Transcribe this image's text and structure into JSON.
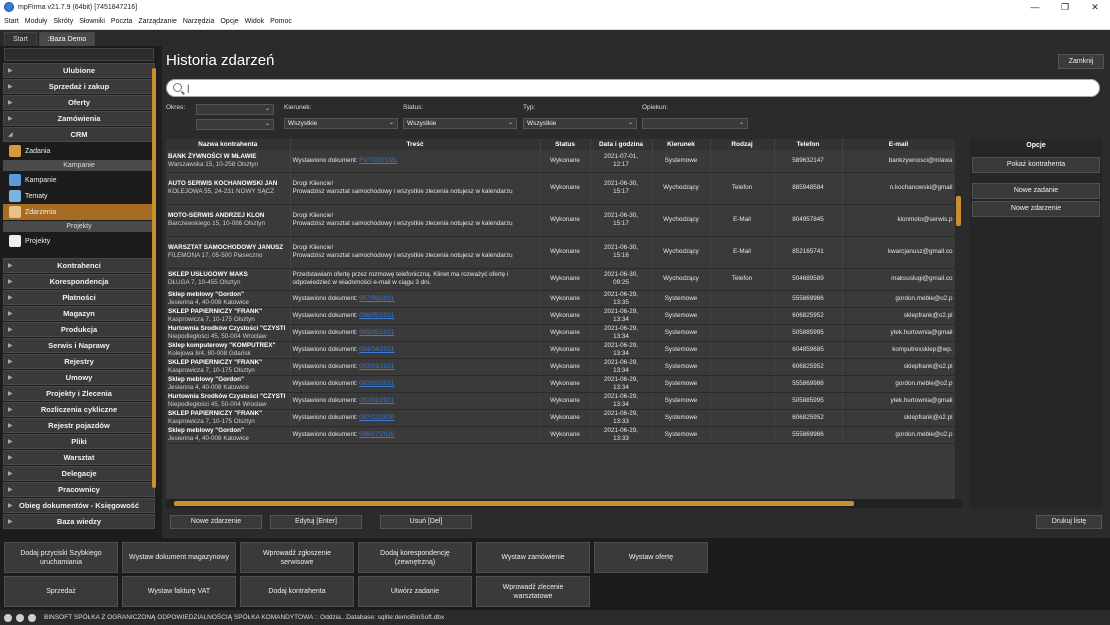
{
  "window": {
    "title": "mpFirma v21.7.9 (64bit) [7451847216]",
    "minimize": "—",
    "maximize": "❐",
    "close": "✕"
  },
  "menu": [
    "Start",
    "Moduły",
    "Skróty",
    "Słowniki",
    "Poczta",
    "Zarządzanie",
    "Narzędzia",
    "Opcje",
    "Widok",
    "Pomoc"
  ],
  "top_tabs": [
    "Start",
    ":Baza Demo"
  ],
  "sidebar": {
    "groups_top": [
      "Ulubione",
      "Sprzedaż i zakup",
      "Oferty",
      "Zamówienia",
      "CRM"
    ],
    "crm_items": [
      {
        "label": "Zadania",
        "section": "Kampanie"
      },
      {
        "label": "Kampanie"
      },
      {
        "label": "Tematy"
      },
      {
        "label": "Zdarzenia",
        "section": "Projekty",
        "active": true
      },
      {
        "label": "Projekty"
      }
    ],
    "groups_bottom": [
      "Kontrahenci",
      "Korespondencja",
      "Płatności",
      "Magazyn",
      "Produkcja",
      "Serwis i Naprawy",
      "Rejestry",
      "Umowy",
      "Projekty i Zlecenia",
      "Rozliczenia cykliczne",
      "Rejestr pojazdów",
      "Pliki",
      "Warsztat",
      "Delegacje",
      "Pracownicy",
      "Obieg dokumentów - Księgowość",
      "Baza wiedzy"
    ]
  },
  "main": {
    "title": "Historia zdarzeń",
    "close_label": "Zamknij",
    "search_value": "|",
    "filters": [
      {
        "label": "Okres:",
        "value": ""
      },
      {
        "label": "Kierunek:",
        "value": "Wszystkie"
      },
      {
        "label": "Status:",
        "value": "Wszystkie"
      },
      {
        "label": "Typ:",
        "value": "Wszystkie"
      },
      {
        "label": "Opiekun:",
        "value": ""
      }
    ],
    "columns": [
      "Nazwa kontrahenta",
      "Treść",
      "Status",
      "Data i godzina",
      "Kierunek",
      "Rodzaj",
      "Telefon",
      "E-mail"
    ],
    "rows": [
      {
        "name": "BANK ŻYWNOŚCI W MŁAWIE",
        "addr": "Warszawska 15, 10-258 Olsztyn",
        "text": "Wystawiono dokument: ",
        "link": "FV/7/2021/ZL",
        "status": "Wykonane",
        "date": "2021-07-01,",
        "time": "12:17",
        "dir": "Systemowe",
        "kind": "",
        "phone": "589632147",
        "email": "bankzywnosci@mlawa",
        "size": "r2"
      },
      {
        "name": "AUTO SERWIS KOCHANOWSKI JAN",
        "addr": "KOLEJOWA 55, 24-231 NOWY SĄCZ",
        "text": "Drogi Kliencie!",
        "text2": "Prowadzisz warsztat samochodowy i wszystkie zlecenia notujesz w kalendarzu",
        "status": "Wykonane",
        "date": "2021-06-30,",
        "time": "15:17",
        "dir": "Wychodzący",
        "kind": "Telefon",
        "phone": "885948584",
        "email": "n.kochanowski@gmail",
        "size": "r3"
      },
      {
        "name": "MOTO-SERWIS ANDRZEJ KLON",
        "addr": "Barczewskiego 15, 10-086 Olsztyn",
        "text": "Drogi Kliencie!",
        "text2": "Prowadzisz warsztat samochodowy i wszystkie zlecenia notujesz w kalendarzu",
        "status": "Wykonane",
        "date": "2021-06-30,",
        "time": "15:17",
        "dir": "Wychodzący",
        "kind": "E-Mail",
        "phone": "804957845",
        "email": "klonmoto@serwis.p",
        "size": "r3"
      },
      {
        "name": "WARSZTAT SAMOCHODOWY JANUSZ",
        "addr": "FILEMONA 17, 05-500 Piaseczno",
        "text": "Drogi Kliencie!",
        "text2": "Prowadzisz warsztat samochodowy i wszystkie zlecenia notujesz w kalendarzu",
        "status": "Wykonane",
        "date": "2021-06-30,",
        "time": "15:16",
        "dir": "Wychodzący",
        "kind": "E-Mail",
        "phone": "852165741",
        "email": "kwarcjanusz@gmail.co",
        "size": "r3"
      },
      {
        "name": "SKLEP USŁUGOWY MAKS",
        "addr": "DŁUGA 7, 10-455 Olsztyn",
        "text": "Przedstawiam ofertę przez rozmowę telefoniczną. Klinet ma rozważyć ofertę i",
        "text2": "odpowiedzieć w wiadomości e-mail w ciągu 3 dni.",
        "status": "Wykonane",
        "date": "2021-06-30,",
        "time": "09:25",
        "dir": "Wychodzący",
        "kind": "Telefon",
        "phone": "504689589",
        "email": "maksuslugi@gmail.co",
        "size": "r2"
      },
      {
        "name": "Sklep meblowy \"Gordon\"",
        "addr": "Jesienna 4, 40-008 Katowice",
        "text": "Wystawiono dokument: ",
        "link": "007/06/2021",
        "status": "Wykonane",
        "date": "2021-06-29,",
        "time": "13:35",
        "dir": "Systemowe",
        "kind": "",
        "phone": "555869986",
        "email": "gordon.meble@o2.p",
        "size": "r1"
      },
      {
        "name": "SKLEP PAPIERNICZY \"FRANK\"",
        "addr": "Kasprowicza 7, 10-175 Olsztyn",
        "text": "Wystawiono dokument: ",
        "link": "006/05/2021",
        "status": "Wykonane",
        "date": "2021-06-29,",
        "time": "13:34",
        "dir": "Systemowe",
        "kind": "",
        "phone": "606825952",
        "email": "sklepfrank@o2.pl",
        "size": "r1"
      },
      {
        "name": "Hurtownia Środków Czystości \"CZYSTI",
        "addr": "Niepodległości 45, 50-004 Wrocław",
        "text": "Wystawiono dokument: ",
        "link": "005/05/2021",
        "status": "Wykonane",
        "date": "2021-06-29,",
        "time": "13:34",
        "dir": "Systemowe",
        "kind": "",
        "phone": "505885995",
        "email": "ytek.hurtownia@gmail",
        "size": "r1"
      },
      {
        "name": "Sklep komputerowy \"KOMPUTREX\"",
        "addr": "Kolejowa 8/4, 80-008 Gdańsk",
        "text": "Wystawiono dokument: ",
        "link": "004/04/2021",
        "status": "Wykonane",
        "date": "2021-06-29,",
        "time": "13:34",
        "dir": "Systemowe",
        "kind": "",
        "phone": "604859685",
        "email": "komputrexsklep@wp.",
        "size": "r1"
      },
      {
        "name": "SKLEP PAPIERNICZY \"FRANK\"",
        "addr": "Kasprowicza 7, 10-175 Olsztyn",
        "text": "Wystawiono dokument: ",
        "link": "003/03/2021",
        "status": "Wykonane",
        "date": "2021-06-29,",
        "time": "13:34",
        "dir": "Systemowe",
        "kind": "",
        "phone": "606825952",
        "email": "sklepfrank@o2.pl",
        "size": "r1"
      },
      {
        "name": "Sklep meblowy \"Gordon\"",
        "addr": "Jesienna 4, 40-008 Katowice",
        "text": "Wystawiono dokument: ",
        "link": "002/02/2021",
        "status": "Wykonane",
        "date": "2021-06-29,",
        "time": "13:34",
        "dir": "Systemowe",
        "kind": "",
        "phone": "555869986",
        "email": "gordon.meble@o2.p",
        "size": "r1"
      },
      {
        "name": "Hurtownia Środków Czystości \"CZYSTI",
        "addr": "Niepodległości 45, 50-004 Wrocław",
        "text": "Wystawiono dokument: ",
        "link": "001/01/2021",
        "status": "Wykonane",
        "date": "2021-06-29,",
        "time": "13:34",
        "dir": "Systemowe",
        "kind": "",
        "phone": "505885995",
        "email": "ytek.hurtownia@gmail",
        "size": "r1"
      },
      {
        "name": "SKLEP PAPIERNICZY \"FRANK\"",
        "addr": "Kasprowicza 7, 10-175 Olsztyn",
        "text": "Wystawiono dokument: ",
        "link": "007/12/2020",
        "status": "Wykonane",
        "date": "2021-06-29,",
        "time": "13:33",
        "dir": "Systemowe",
        "kind": "",
        "phone": "606825952",
        "email": "sklepfrank@o2.pl",
        "size": "r1"
      },
      {
        "name": "Sklep meblowy \"Gordon\"",
        "addr": "Jesienna 4, 40-008 Katowice",
        "text": "Wystawiono dokument: ",
        "link": "006/07/2020",
        "status": "Wykonane",
        "date": "2021-06-29,",
        "time": "13:33",
        "dir": "Systemowe",
        "kind": "",
        "phone": "555869986",
        "email": "gordon.meble@o2.p",
        "size": "r1"
      }
    ],
    "options_title": "Opcje",
    "options": [
      "Pokaż kontrahenta",
      "Nowe zadanie",
      "Nowe zdarzenie"
    ],
    "actions": [
      "Nowe zdarzenie",
      "Edytuj [Enter]",
      "Usuń [Del]"
    ],
    "print_label": "Drukuj listę"
  },
  "quick": [
    "Dodaj przyciski Szybkiego uruchamiania",
    "Wystaw dokument magazynowy",
    "Wprowadź zgłoszenie serwisowe",
    "Dodaj korespondencję (zewnętrzną)",
    "Wystaw zamówienie",
    "Wystaw ofertę",
    "Sprzedaż",
    "Wystaw fakturę VAT",
    "Dodaj kontrahenta",
    "Utwórz zadanie",
    "Wprowadź zlecenie warsztatowe"
  ],
  "status_text": "BINSOFT SPÓŁKA Z OGRANICZONĄ ODPOWIEDZIALNOŚCIĄ SPÓŁKA KOMANDYTOWA :: Oddzia...Database: sqlite:demoBinSoft.dbx",
  "colors": {
    "accent": "#c8902e",
    "link": "#3a7bd5"
  }
}
